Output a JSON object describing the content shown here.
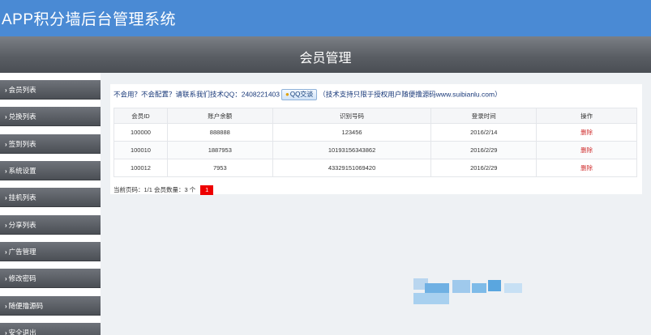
{
  "app": {
    "title": "APP积分墙后台管理系统"
  },
  "header": {
    "page_title": "会员管理"
  },
  "sidebar": {
    "items": [
      {
        "label": "会员列表"
      },
      {
        "label": "兑换列表"
      },
      {
        "label": "签到列表"
      },
      {
        "label": "系统设置"
      },
      {
        "label": "挂机列表"
      },
      {
        "label": "分享列表"
      },
      {
        "label": "广告管理"
      },
      {
        "label": "修改密码"
      },
      {
        "label": "随便撸源码"
      },
      {
        "label": "安全退出"
      }
    ]
  },
  "notice": {
    "prefix": "不会用？不会配置？请联系我们技术QQ：2408221403",
    "qq_button": "QQ交谈",
    "suffix": "（技术支持只限于授权用户随便撸源码www.suibianlu.com）"
  },
  "table": {
    "headers": [
      "会员ID",
      "账户余额",
      "识别号码",
      "登录时间",
      "操作"
    ],
    "rows": [
      {
        "id": "100000",
        "balance": "888888",
        "code": "123456",
        "login": "2016/2/14",
        "action": "删除"
      },
      {
        "id": "100010",
        "balance": "1887953",
        "code": "10193156343862",
        "login": "2016/2/29",
        "action": "删除"
      },
      {
        "id": "100012",
        "balance": "7953",
        "code": "43329151069420",
        "login": "2016/2/29",
        "action": "删除"
      }
    ]
  },
  "pager": {
    "text": "当前页码：1/1   会员数量：3 个",
    "current_page": "1"
  },
  "colors": {
    "topbar": "#4a8ad4",
    "delete_link": "#d03030",
    "page_active": "#ee0000"
  }
}
